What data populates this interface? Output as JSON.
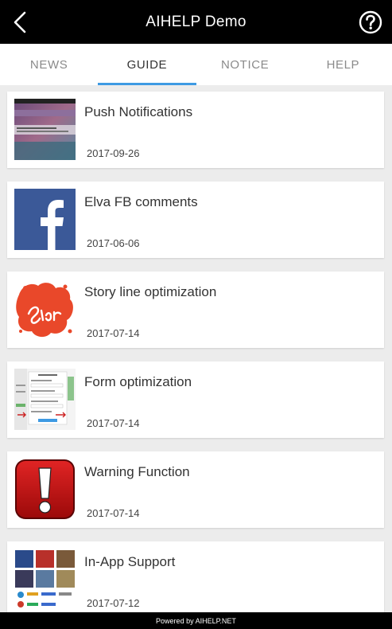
{
  "header": {
    "title": "AIHELP Demo",
    "back_icon": "chevron-left-icon",
    "help_icon": "question-circle-icon"
  },
  "tabs": [
    {
      "label": "NEWS",
      "active": false
    },
    {
      "label": "GUIDE",
      "active": true
    },
    {
      "label": "NOTICE",
      "active": false
    },
    {
      "label": "HELP",
      "active": false
    }
  ],
  "colors": {
    "accent": "#3e9ae3",
    "header_bg": "#000000",
    "list_bg": "#ececec"
  },
  "articles": [
    {
      "title": "Push Notifications",
      "date": "2017-09-26",
      "thumb_icon": "phone-screenshot-thumbnail"
    },
    {
      "title": "Elva FB comments",
      "date": "2017-06-06",
      "thumb_icon": "facebook-logo-icon"
    },
    {
      "title": "Story line optimization",
      "date": "2017-07-14",
      "thumb_icon": "storyline-logo-thumbnail"
    },
    {
      "title": "Form optimization",
      "date": "2017-07-14",
      "thumb_icon": "form-screenshot-thumbnail"
    },
    {
      "title": "Warning Function",
      "date": "2017-07-14",
      "thumb_icon": "warning-exclamation-icon"
    },
    {
      "title": "In-App Support",
      "date": "2017-07-12",
      "thumb_icon": "game-icons-collage-thumbnail"
    }
  ],
  "footer": {
    "text": "Powered by AIHELP.NET"
  }
}
